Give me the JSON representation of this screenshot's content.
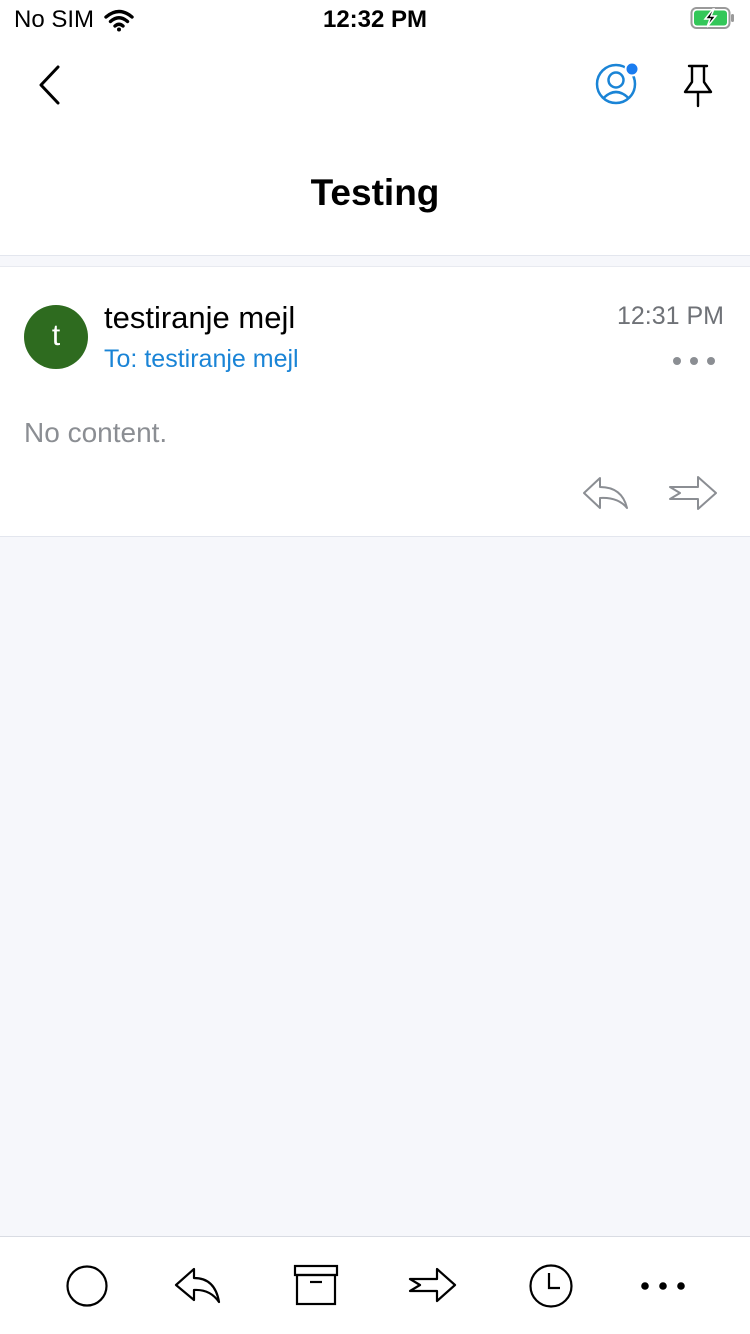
{
  "status_bar": {
    "carrier": "No SIM",
    "time": "12:32 PM",
    "icons": [
      "wifi-icon",
      "battery-charging-icon"
    ]
  },
  "nav": {
    "back_icon": "chevron-left-icon",
    "account_icon": "account-icon",
    "account_badge_color": "#1a7cf0",
    "pin_icon": "pin-icon"
  },
  "page": {
    "title": "Testing"
  },
  "message": {
    "avatar_initial": "t",
    "avatar_color": "#2e6b1f",
    "sender": "testiranje mejl",
    "to_label": "To:",
    "recipient": "testiranje mejl",
    "time": "12:31 PM",
    "body": "No content.",
    "actions": [
      "more-options-icon",
      "reply-icon",
      "forward-icon"
    ]
  },
  "toolbar": {
    "items": [
      "mark-unread-icon",
      "reply-icon",
      "archive-icon",
      "forward-icon",
      "snooze-icon",
      "more-icon"
    ]
  },
  "colors": {
    "accent": "#1a84d6",
    "background": "#f6f7fb",
    "secondary_text": "#8b8e93"
  }
}
